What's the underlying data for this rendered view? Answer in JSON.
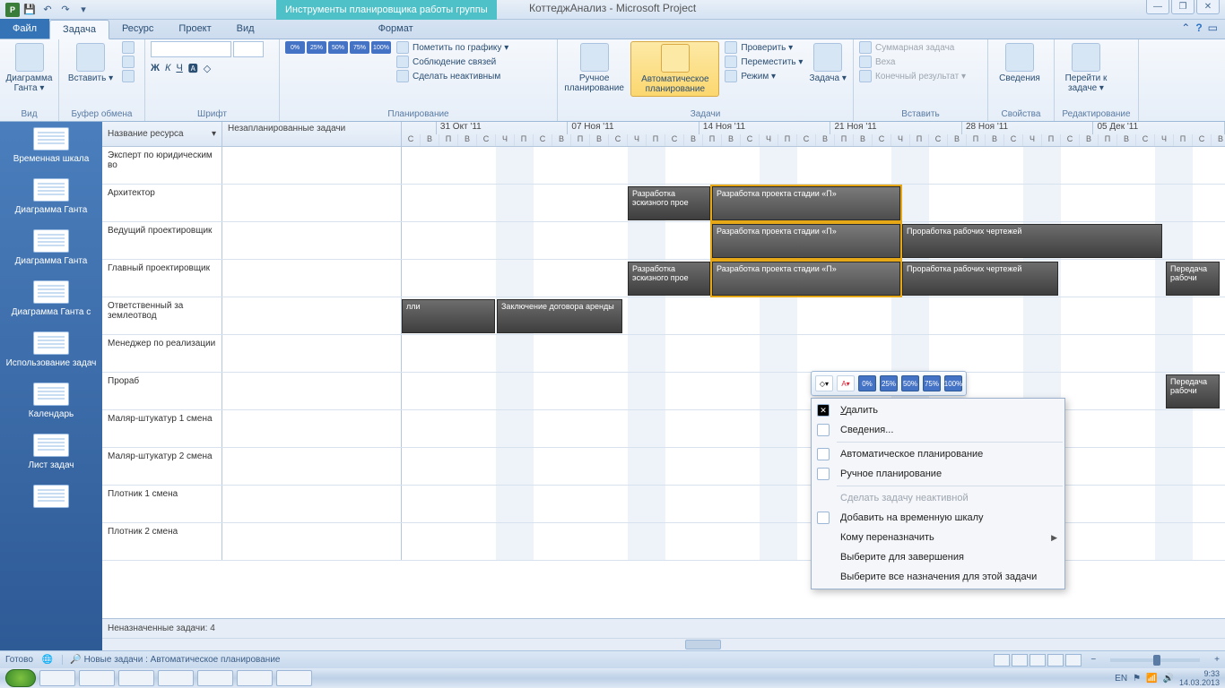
{
  "window": {
    "title": "КоттеджАнализ - Microsoft Project",
    "context_tab": "Инструменты планировщика работы группы",
    "min": "—",
    "max": "❐",
    "close": "✕"
  },
  "tabs": {
    "file": "Файл",
    "task": "Задача",
    "resource": "Ресурс",
    "project": "Проект",
    "view": "Вид",
    "format": "Формат"
  },
  "ribbon": {
    "view_group": "Вид",
    "gantt": "Диаграмма Ганта ▾",
    "clipboard": "Буфер обмена",
    "paste": "Вставить ▾",
    "font_group": "Шрифт",
    "schedule_group": "Планирование",
    "mark": "Пометить по графику ▾",
    "links": "Соблюдение связей",
    "inactive": "Сделать неактивным",
    "pcts": [
      "0%",
      "25%",
      "50%",
      "75%",
      "100%"
    ],
    "tasks_group": "Задачи",
    "manual": "Ручное планирование",
    "auto": "Автоматическое планирование",
    "check": "Проверить ▾",
    "move": "Переместить ▾",
    "mode": "Режим ▾",
    "task_btn": "Задача ▾",
    "insert_group": "Вставить",
    "summary": "Суммарная задача",
    "milestone": "Веха",
    "deliverable": "Конечный результат ▾",
    "props_group": "Свойства",
    "info": "Сведения",
    "edit_group": "Редактирование",
    "goto": "Перейти к задаче ▾"
  },
  "views": [
    "Временная шкала",
    "Диаграмма Ганта",
    "Диаграмма Ганта",
    "Диаграмма Ганта с",
    "Использование задач",
    "Календарь",
    "Лист задач"
  ],
  "planner": {
    "col_resource": "Название ресурса",
    "col_unsched": "Незапланированные задачи",
    "months": [
      "31 Окт '11",
      "07 Ноя '11",
      "14 Ноя '11",
      "21 Ноя '11",
      "28 Ноя '11",
      "05 Дек '11"
    ],
    "day_letters": [
      "С",
      "В",
      "П",
      "В",
      "С",
      "Ч",
      "П"
    ],
    "resources": [
      "Эксперт по юридическим во",
      "Архитектор",
      "Ведущий проектировщик",
      "Главный проектировщик",
      "Ответственный за землеотвод",
      "Менеджер по реализации",
      "Прораб",
      "Маляр-штукатур 1 смена",
      "Маляр-штукатур 2 смена",
      "Плотник 1 смена",
      "Плотник 2 смена"
    ],
    "tasks": {
      "t_sketch": "Разработка эскизного прое",
      "t_stageP": "Разработка проекта стадии «П»",
      "t_draw": "Проработка рабочих чертежей",
      "t_lease": "Заключение договора аренды",
      "t_transfer": "Передача рабочи",
      "t_lli": "лли"
    },
    "unassigned": "Неназначенные задачи: 4"
  },
  "ctx": {
    "delete": "Удалить",
    "info": "Сведения...",
    "auto": "Автоматическое планирование",
    "manual": "Ручное планирование",
    "inactive": "Сделать задачу неактивной",
    "timeline": "Добавить на временную шкалу",
    "reassign": "Кому переназначить",
    "complete": "Выберите для завершения",
    "selectall": "Выберите все назначения для этой задачи"
  },
  "status": {
    "ready": "Готово",
    "newtasks": "Новые задачи : Автоматическое планирование"
  },
  "tray": {
    "lang": "EN",
    "time": "9:33",
    "date": "14.03.2013"
  }
}
